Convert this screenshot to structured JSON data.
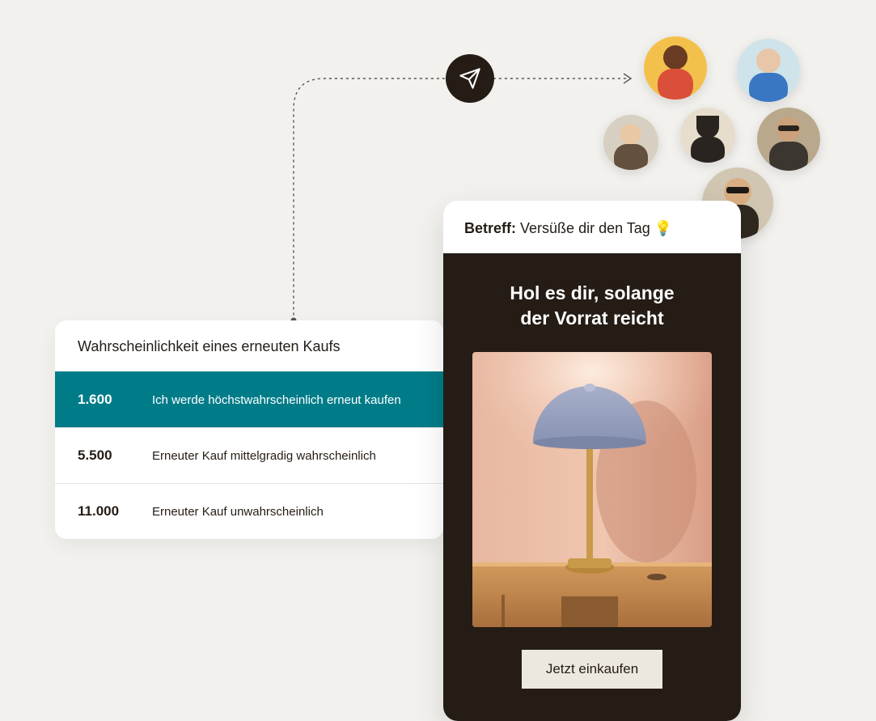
{
  "probability": {
    "title": "Wahrscheinlichkeit eines erneuten Kaufs",
    "rows": [
      {
        "count": "1.600",
        "label": "Ich werde höchstwahrscheinlich erneut kaufen",
        "selected": true
      },
      {
        "count": "5.500",
        "label": "Erneuter Kauf mittelgradig wahrscheinlich",
        "selected": false
      },
      {
        "count": "11.000",
        "label": "Erneuter Kauf unwahrscheinlich",
        "selected": false
      }
    ]
  },
  "email": {
    "subject_label": "Betreff:",
    "subject_text": "Versüße dir den Tag 💡",
    "headline_line1": "Hol es dir, solange",
    "headline_line2": "der Vorrat reicht",
    "cta": "Jetzt einkaufen"
  }
}
